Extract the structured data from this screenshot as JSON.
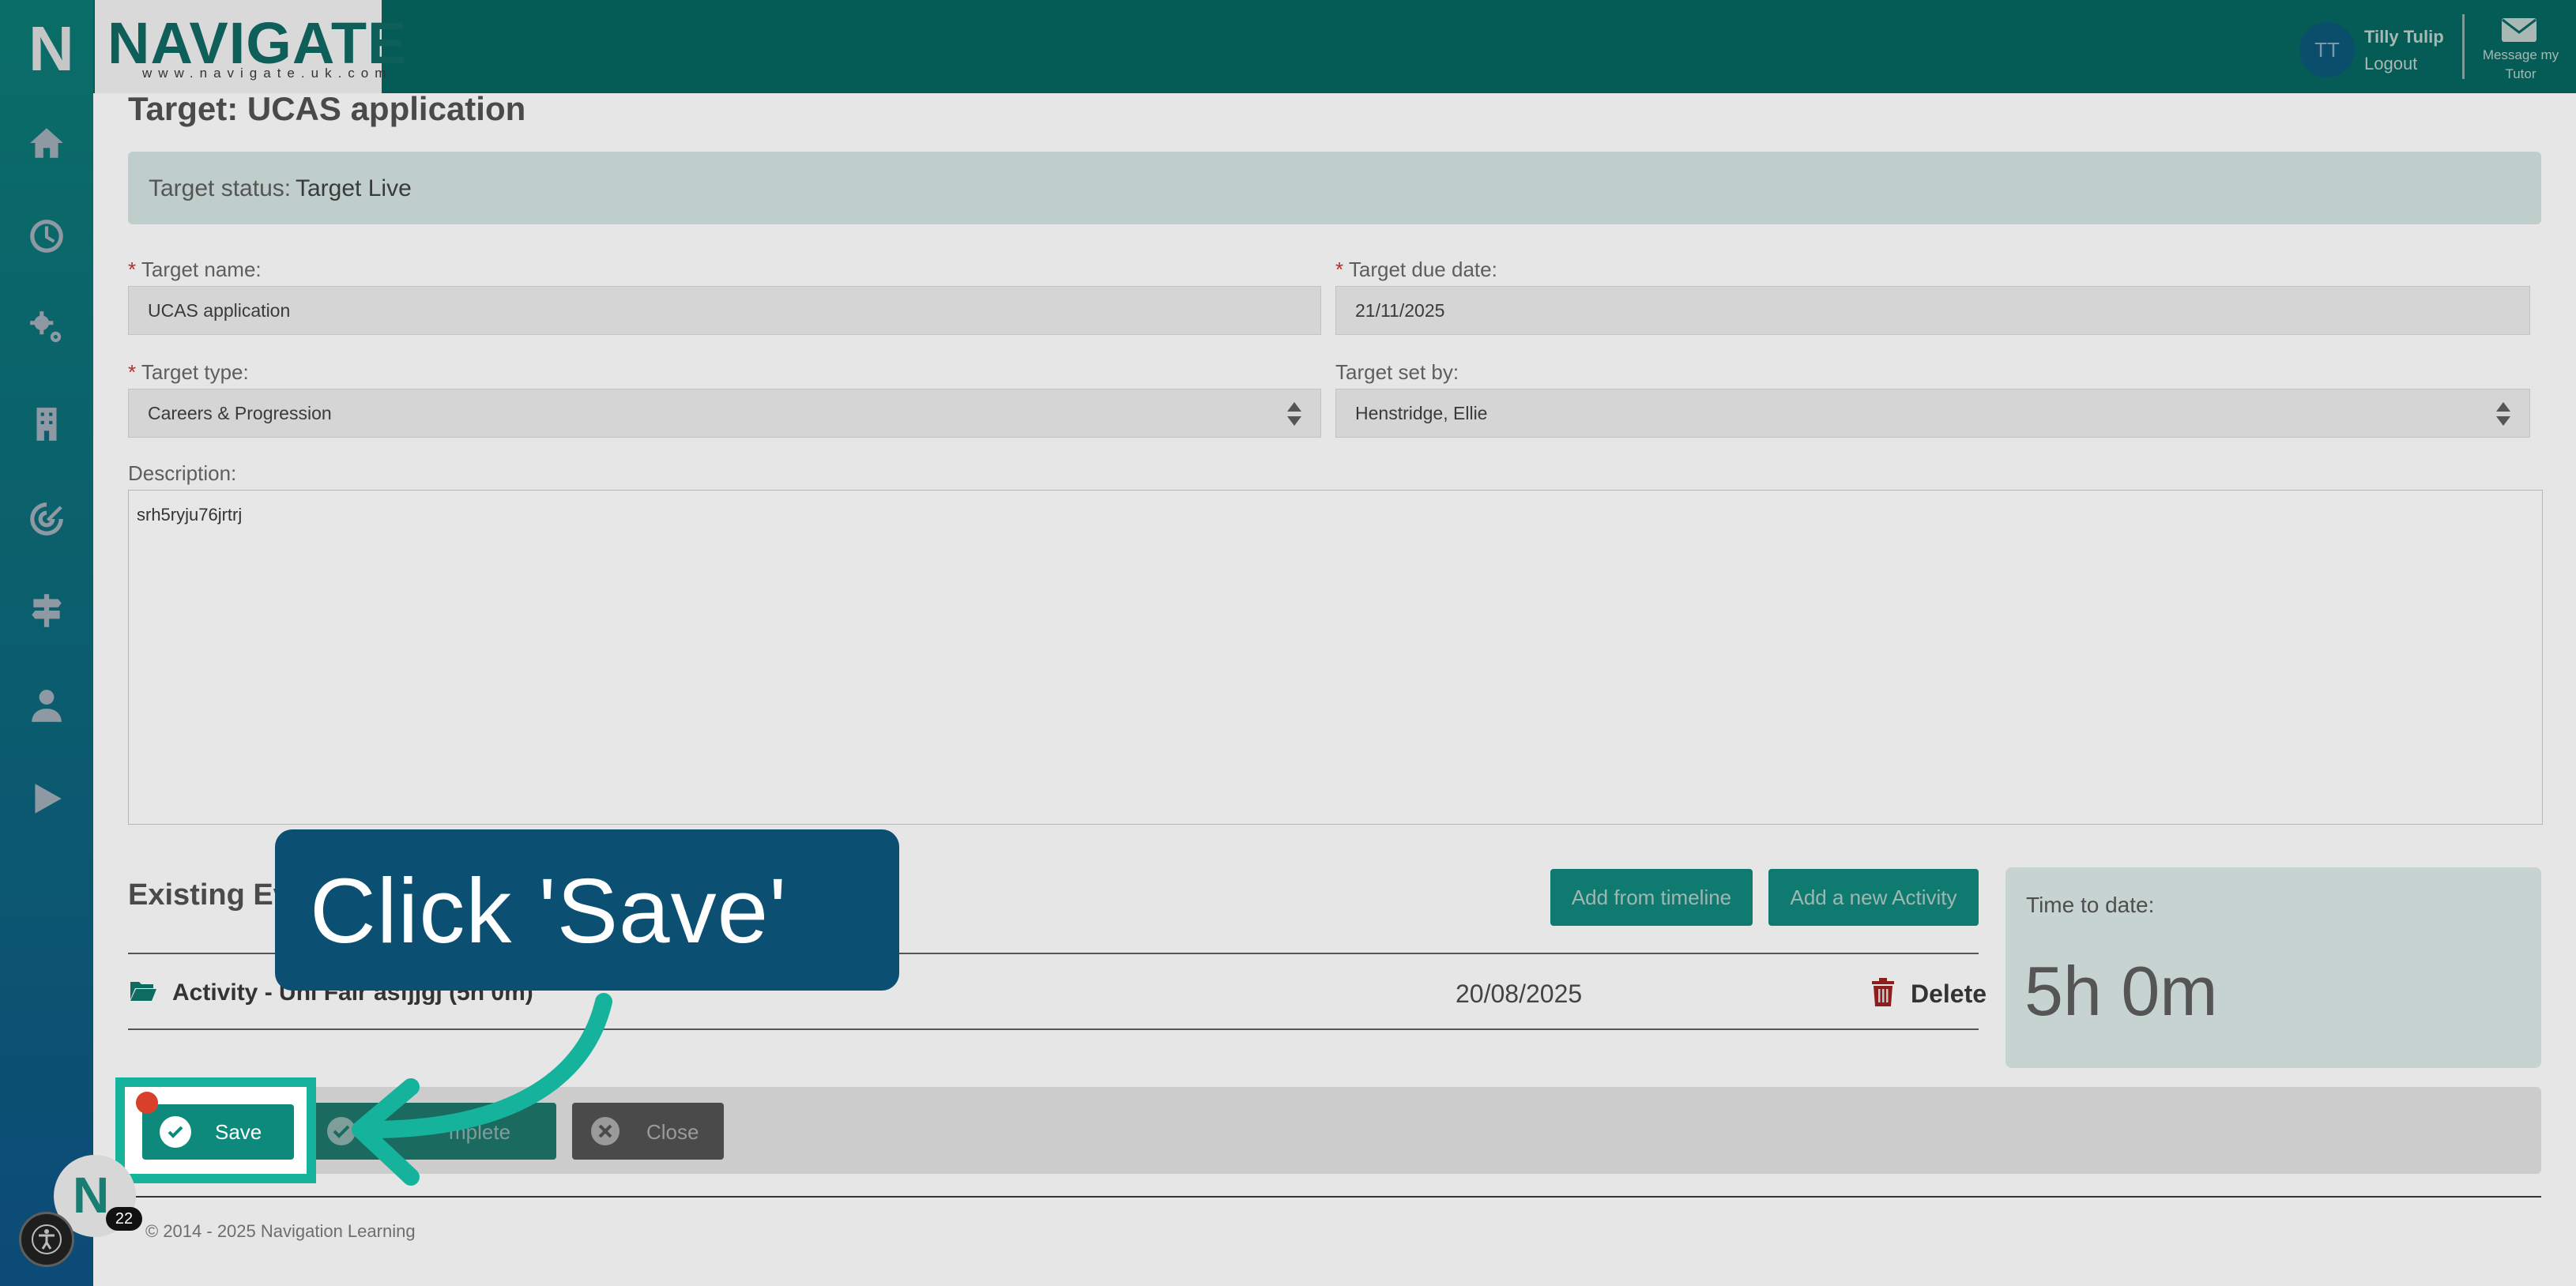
{
  "header": {
    "logo_text": "NAVIGATE",
    "logo_url": "www.navigate.uk.com",
    "side_logo": "N",
    "user_initials": "TT",
    "user_name": "Tilly Tulip",
    "logout_label": "Logout",
    "message_label": "Message my Tutor"
  },
  "sidebar": {
    "items": [
      {
        "icon": "home-icon"
      },
      {
        "icon": "clock-icon"
      },
      {
        "icon": "gears-icon"
      },
      {
        "icon": "building-icon"
      },
      {
        "icon": "target-icon"
      },
      {
        "icon": "signpost-icon"
      },
      {
        "icon": "person-icon"
      },
      {
        "icon": "play-icon"
      }
    ]
  },
  "page": {
    "title": "Target: UCAS application",
    "status_label": "Target status:",
    "status_value": "Target Live"
  },
  "form": {
    "required_mark": "*",
    "name_label": "Target name:",
    "name_value": "UCAS application",
    "due_label": "Target due date:",
    "due_value": "21/11/2025",
    "type_label": "Target type:",
    "type_value": "Careers & Progression",
    "setby_label": "Target set by:",
    "setby_value": "Henstridge, Ellie",
    "description_label": "Description:",
    "description_value": "srh5ryju76jrtrj"
  },
  "evidence": {
    "title": "Existing Ev",
    "add_timeline_label": "Add from timeline",
    "add_activity_label": "Add a new Activity",
    "activities": [
      {
        "name": "Activity - Uni Fair asfjjgj (5h 0m)",
        "date": "20/08/2025",
        "delete_label": "Delete"
      }
    ],
    "time_label": "Time to date:",
    "time_value": "5h 0m"
  },
  "actions": {
    "save_label": "Save",
    "complete_label": "mplete",
    "close_label": "Close"
  },
  "footer": {
    "copyright": "© 2014 - 2025 Navigation Learning"
  },
  "overlay": {
    "callout_text": "Click 'Save'",
    "fab_letter": "N",
    "fab_badge": "22"
  },
  "colors": {
    "teal": "#0d8a7c",
    "highlight": "#16b39c",
    "callout": "#0b4f73",
    "marker": "#d8402c"
  }
}
